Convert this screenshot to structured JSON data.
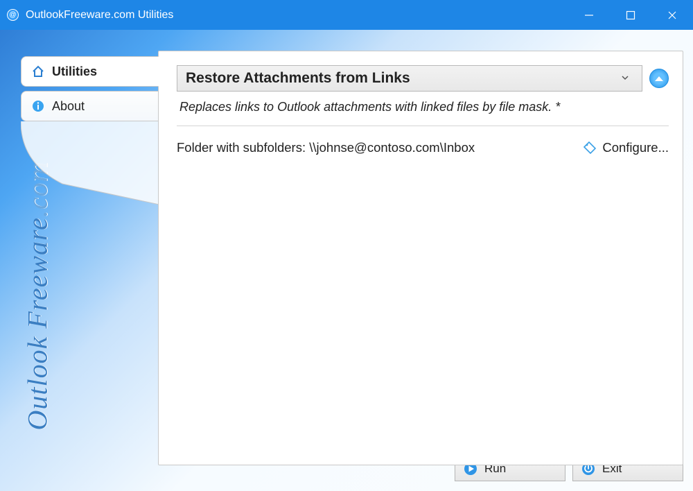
{
  "window": {
    "title": "OutlookFreeware.com Utilities"
  },
  "tabs": {
    "utilities": "Utilities",
    "about": "About"
  },
  "utility": {
    "selected": "Restore Attachments from Links",
    "description": "Replaces links to Outlook attachments with linked files by file mask. *"
  },
  "folder": {
    "label_full": "Folder with subfolders: \\\\johnse@contoso.com\\Inbox",
    "configure": "Configure..."
  },
  "brand": {
    "name": "Outlook Freeware",
    "suffix": ".com"
  },
  "footer": {
    "run": "Run",
    "exit": "Exit"
  }
}
